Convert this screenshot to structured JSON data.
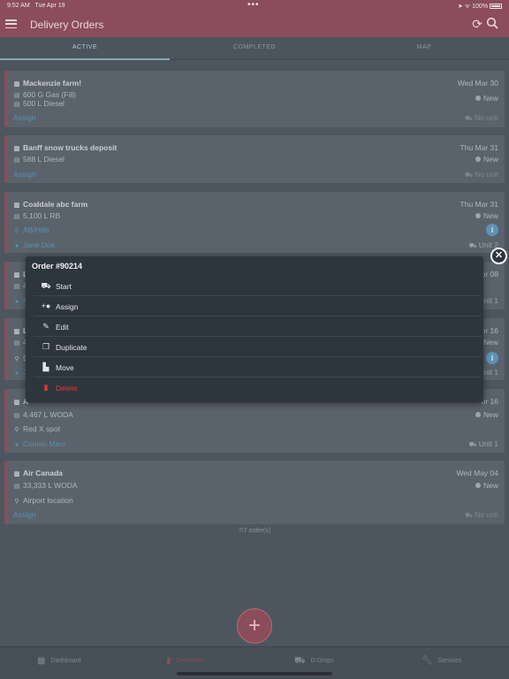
{
  "status_bar": {
    "time": "9:52 AM",
    "date": "Tue Apr 19",
    "battery": "100%"
  },
  "app_bar": {
    "title": "Delivery Orders"
  },
  "tabs": [
    {
      "label": "ACTIVE"
    },
    {
      "label": "COMPLETED"
    },
    {
      "label": "MAP"
    }
  ],
  "orders": [
    {
      "name": "Mackenzie farm!",
      "date": "Wed Mar 30",
      "lines": [
        "600 G Gas (Fill)",
        "500 L Diesel"
      ],
      "status": "New",
      "assign": "Assign",
      "vehicle": "No unit"
    },
    {
      "name": "Banff snow trucks deposit",
      "date": "Thu Mar 31",
      "lines": [
        "588 L Diesel"
      ],
      "status": "New",
      "assign": "Assign",
      "vehicle": "No unit"
    },
    {
      "name": "Coaldale abc farm",
      "date": "Thu Mar 31",
      "lines": [
        "5,100 L RB"
      ],
      "location": "AB/Hills",
      "status": "New",
      "driver": "Jane Doe",
      "vehicle": "Unit 2"
    },
    {
      "name": "L",
      "date": "or 08",
      "line_partial": "4",
      "driver_partial": "R",
      "vehicle": "Unit 1"
    },
    {
      "name": "L",
      "date": "or 16",
      "line_partial": "4",
      "location_partial": "9",
      "driver_partial": "J",
      "status": "New",
      "vehicle": "Unit 1"
    },
    {
      "name": "A",
      "date": "or 16",
      "lines": [
        "4,467 L WODA"
      ],
      "location": "Red X spot",
      "status": "New",
      "driver": "Conian Mars",
      "vehicle": "Unit 1"
    },
    {
      "name": "Air Canada",
      "date": "Wed May 04",
      "lines": [
        "33,333 L WODA"
      ],
      "location": "Airport location",
      "status": "New",
      "assign": "Assign",
      "vehicle": "No unit"
    }
  ],
  "footer": {
    "count": "7/7 order(s)"
  },
  "fab": {
    "label": "+"
  },
  "bottom_nav": [
    {
      "label": "Dashboard"
    },
    {
      "label": "Deliveries"
    },
    {
      "label": "D-Drops"
    },
    {
      "label": "Services"
    }
  ],
  "popup": {
    "title": "Order #90214",
    "items": [
      {
        "label": "Start",
        "icon": "truck-icon"
      },
      {
        "label": "Assign",
        "icon": "add-person-icon"
      },
      {
        "label": "Edit",
        "icon": "pencil-icon"
      },
      {
        "label": "Duplicate",
        "icon": "copy-icon"
      },
      {
        "label": "Move",
        "icon": "move-file-icon"
      },
      {
        "label": "Delete",
        "icon": "trash-icon"
      }
    ]
  },
  "colors": {
    "accent": "#8a4d59",
    "link": "#5f8fae",
    "danger": "#e53935",
    "popup_bg": "#2d353d"
  }
}
